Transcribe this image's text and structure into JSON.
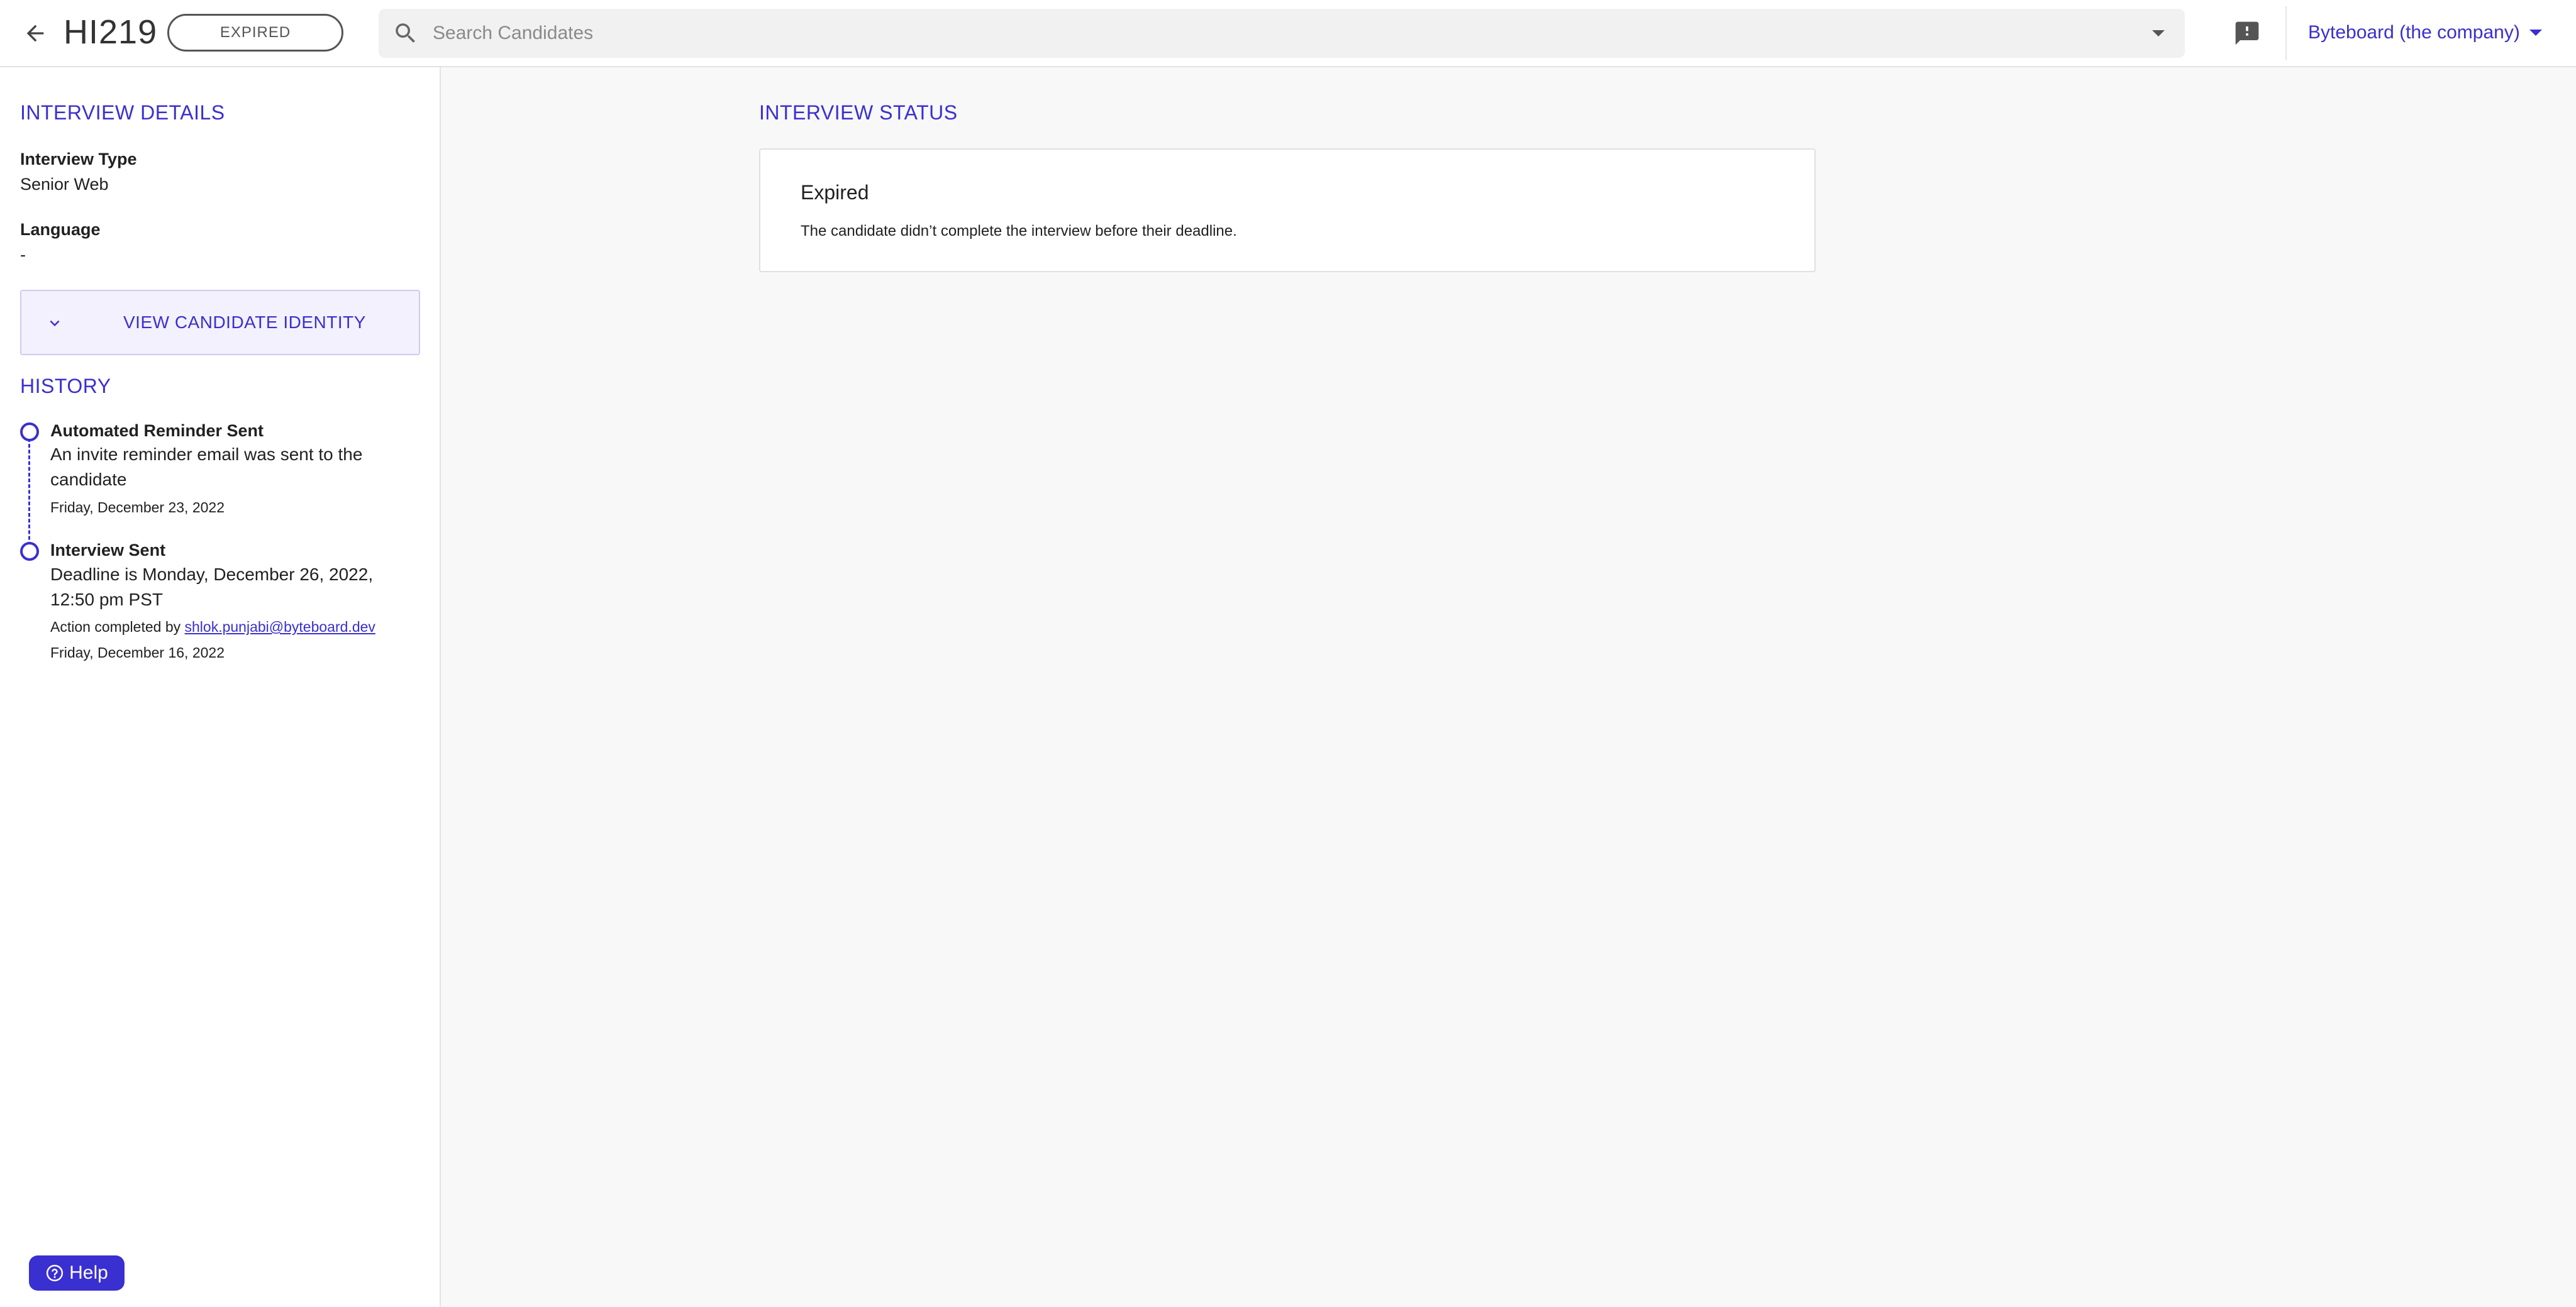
{
  "header": {
    "candidate_name": "HI219",
    "status_chip": "EXPIRED",
    "search_placeholder": "Search Candidates",
    "company": "Byteboard (the company)"
  },
  "sidebar": {
    "details_title": "INTERVIEW DETAILS",
    "fields": [
      {
        "label": "Interview Type",
        "value": "Senior Web"
      },
      {
        "label": "Language",
        "value": "-"
      }
    ],
    "identity_button": "VIEW CANDIDATE IDENTITY",
    "history_title": "HISTORY",
    "history": [
      {
        "title": "Automated Reminder Sent",
        "desc_line1": "An invite reminder email was sent to the",
        "desc_line2": "candidate",
        "date": "Friday, December 23, 2022"
      },
      {
        "title": "Interview Sent",
        "desc_line1": "Deadline is Monday, December 26, 2022,",
        "desc_line2": "12:50 pm PST",
        "action_prefix": "Action completed by",
        "action_user": "shlok.punjabi@byteboard.dev",
        "date": "Friday, December 16, 2022"
      }
    ],
    "help_label": "Help"
  },
  "main": {
    "status_title": "INTERVIEW STATUS",
    "card_title": "Expired",
    "card_desc": "The candidate didn’t complete the interview before their deadline."
  },
  "colors": {
    "accent": "#3a2fd0",
    "page_bg": "#f8f8f8",
    "panel_bg": "#ffffff"
  },
  "icons": [
    "arrow-back-icon",
    "search-icon",
    "dropdown-arrow-icon",
    "feedback-icon",
    "chevron-down-icon",
    "help-circle-icon"
  ]
}
